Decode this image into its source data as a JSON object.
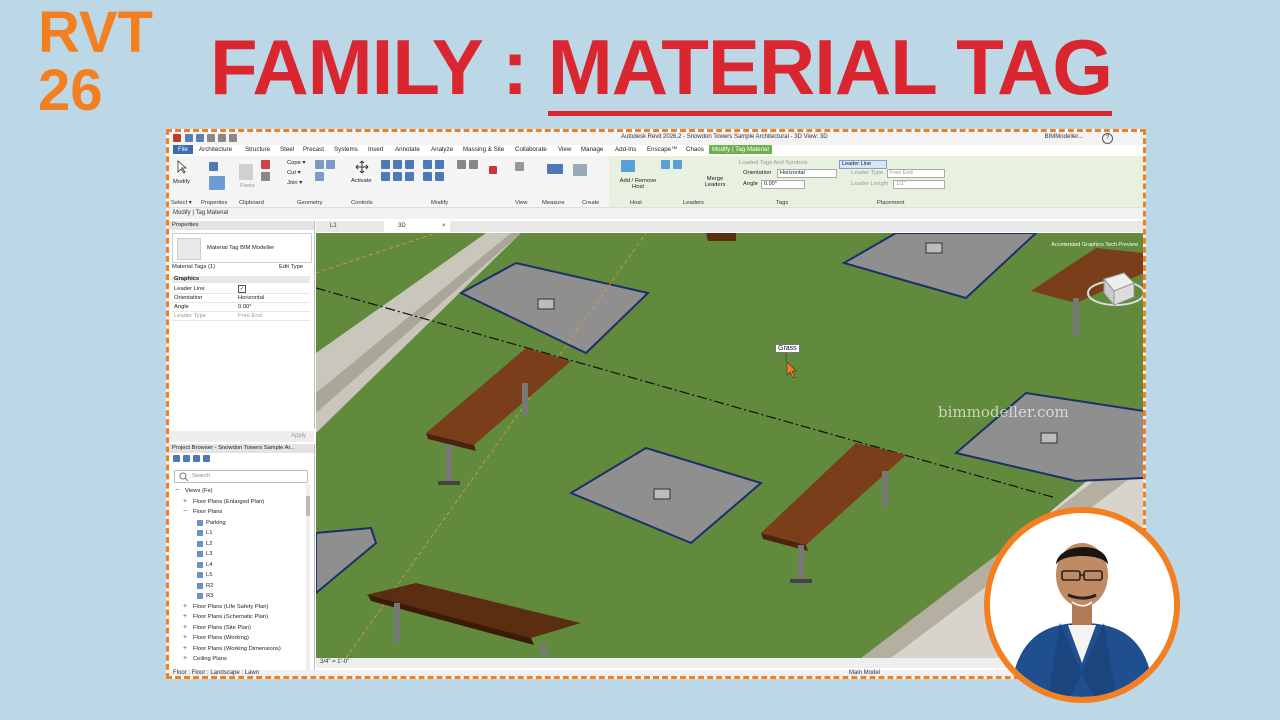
{
  "header": {
    "rvt_line1": "RVT",
    "rvt_line2": "26",
    "title_prefix": "FAMILY : ",
    "title_emphasis": "MATERIAL TAG"
  },
  "colors": {
    "accent_orange": "#f47f20",
    "title_red": "#d9262f",
    "background": "#bcd8e6",
    "grass": "#618a3c",
    "context_tab": "#6cb24c"
  },
  "app": {
    "window_title": "Autodesk Revit 2026.2 - Snowdon Towers Sample Architectural - 3D View: 3D",
    "user": "BIMModeller...",
    "tabs": [
      "File",
      "Architecture",
      "Structure",
      "Steel",
      "Precast",
      "Systems",
      "Insert",
      "Annotate",
      "Analyze",
      "Massing & Site",
      "Collaborate",
      "View",
      "Manage",
      "Add-Ins",
      "Enscape™",
      "Chaos",
      "Modify | Tag Material"
    ],
    "ribbon": {
      "modify_label": "Modify",
      "activate_label": "Activate",
      "panels": [
        "Select ▾",
        "Properties",
        "Clipboard",
        "Geometry",
        "Controls",
        "Modify",
        "View",
        "Measure",
        "Create",
        "Host",
        "Leaders",
        "Tags",
        "Placement"
      ],
      "geometry_items": [
        "Cope ▾",
        "Cut ▾",
        "Join ▾"
      ],
      "paste_label": "Paste",
      "add_remove_host": "Add / Remove Host",
      "merge_leaders": "Merge Leaders",
      "tags": {
        "loaded_tags": "Loaded Tags And Symbols",
        "orientation_label": "Orientation",
        "orientation_value": "Horizontal",
        "angle_label": "Angle",
        "angle_value": "0.00°"
      },
      "placement": {
        "leader_line": "Leader Line",
        "leader_type_label": "Leader Type",
        "leader_type_value": "Free End",
        "leader_length_label": "Leader Length",
        "leader_length_value": "1/2\""
      }
    },
    "options_bar": "Modify | Tag Material",
    "properties": {
      "header": "Properties",
      "type_name": "Material Tag BIM Modeller",
      "selector": "Material Tags (1)",
      "edit_type": "Edit Type",
      "group": "Graphics",
      "rows": [
        {
          "k": "Leader Line",
          "v": ""
        },
        {
          "k": "Orientation",
          "v": "Horizontal"
        },
        {
          "k": "Angle",
          "v": "0.00°"
        },
        {
          "k": "Leader Type",
          "v": "Free End"
        }
      ],
      "apply": "Apply"
    },
    "project_browser": {
      "header": "Project Browser - Snowdon Towers Sample Ar...",
      "search_placeholder": "Search",
      "items": [
        {
          "label": "Views (Fe)",
          "indent": 0,
          "exp": "−"
        },
        {
          "label": "Floor Plans (Enlarged Plan)",
          "indent": 1,
          "exp": "+"
        },
        {
          "label": "Floor Plans",
          "indent": 1,
          "exp": "−"
        },
        {
          "label": "Parking",
          "indent": 2,
          "exp": ""
        },
        {
          "label": "L1",
          "indent": 2,
          "exp": ""
        },
        {
          "label": "L2",
          "indent": 2,
          "exp": ""
        },
        {
          "label": "L3",
          "indent": 2,
          "exp": ""
        },
        {
          "label": "L4",
          "indent": 2,
          "exp": ""
        },
        {
          "label": "L5",
          "indent": 2,
          "exp": ""
        },
        {
          "label": "R2",
          "indent": 2,
          "exp": ""
        },
        {
          "label": "R3",
          "indent": 2,
          "exp": ""
        },
        {
          "label": "Floor Plans (Life Safety Plan)",
          "indent": 1,
          "exp": "+"
        },
        {
          "label": "Floor Plans (Schematic Plan)",
          "indent": 1,
          "exp": "+"
        },
        {
          "label": "Floor Plans (Site Plan)",
          "indent": 1,
          "exp": "+"
        },
        {
          "label": "Floor Plans (Working)",
          "indent": 1,
          "exp": "+"
        },
        {
          "label": "Floor Plans (Working Dimensions)",
          "indent": 1,
          "exp": "+"
        },
        {
          "label": "Ceiling Plans",
          "indent": 1,
          "exp": "+"
        }
      ]
    },
    "view_tabs": {
      "tab1": "L1",
      "tab2": "3D"
    },
    "view_scale": "3/4\" = 1'-0\"",
    "status": "Floor : Floor : Landscape : Lawn",
    "status_right": "Main Model",
    "viewport": {
      "tag_text": "Grass",
      "watermark": "bimmodeller.com",
      "hud": "Accelerated Graphics Tech Preview",
      "viewcube": "RIGHT"
    }
  }
}
